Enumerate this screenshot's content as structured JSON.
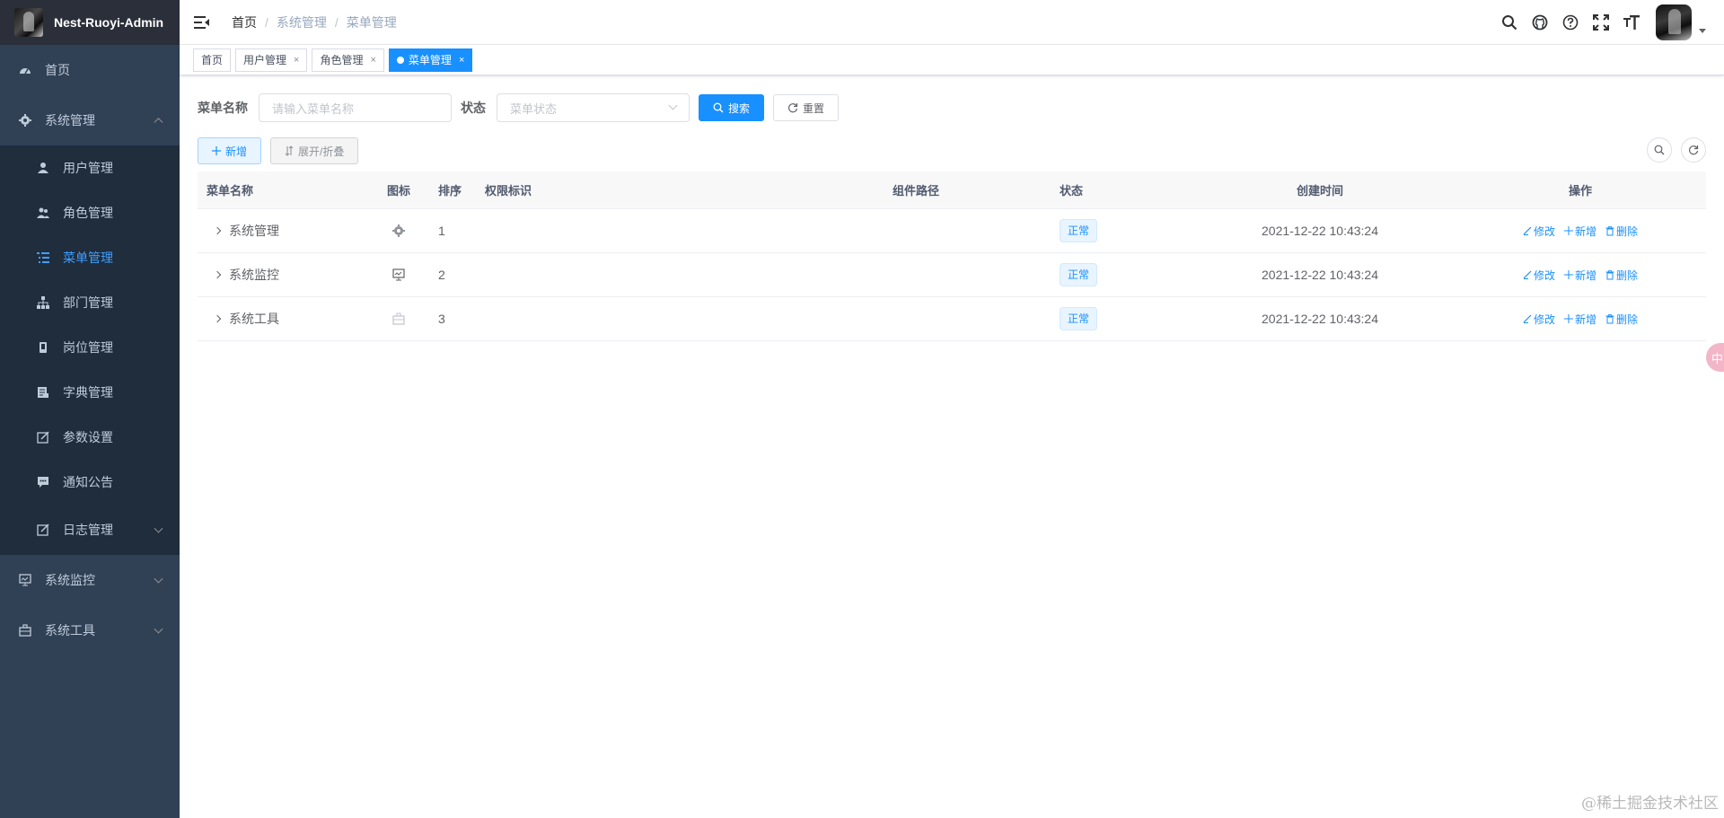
{
  "app": {
    "title": "Nest-Ruoyi-Admin"
  },
  "sidebar": {
    "home": "首页",
    "system": {
      "label": "系统管理",
      "items": [
        {
          "label": "用户管理",
          "icon": "user-icon"
        },
        {
          "label": "角色管理",
          "icon": "peoples-icon"
        },
        {
          "label": "菜单管理",
          "icon": "tree-table-icon"
        },
        {
          "label": "部门管理",
          "icon": "tree-icon"
        },
        {
          "label": "岗位管理",
          "icon": "post-icon"
        },
        {
          "label": "字典管理",
          "icon": "dict-icon"
        },
        {
          "label": "参数设置",
          "icon": "edit-icon"
        },
        {
          "label": "通知公告",
          "icon": "message-icon"
        },
        {
          "label": "日志管理",
          "icon": "log-icon"
        }
      ]
    },
    "monitor": "系统监控",
    "tool": "系统工具"
  },
  "navbar": {
    "breadcrumb": [
      "首页",
      "系统管理",
      "菜单管理"
    ],
    "separator": "/"
  },
  "tags": [
    {
      "label": "首页",
      "closable": false
    },
    {
      "label": "用户管理",
      "closable": true
    },
    {
      "label": "角色管理",
      "closable": true
    },
    {
      "label": "菜单管理",
      "closable": true,
      "active": true
    }
  ],
  "tag_close": "×",
  "search": {
    "name_label": "菜单名称",
    "name_placeholder": "请输入菜单名称",
    "status_label": "状态",
    "status_placeholder": "菜单状态",
    "search_btn": "搜索",
    "reset_btn": "重置"
  },
  "toolbar": {
    "add_btn": "新增",
    "expand_btn": "展开/折叠"
  },
  "table": {
    "headers": [
      "菜单名称",
      "图标",
      "排序",
      "权限标识",
      "组件路径",
      "状态",
      "创建时间",
      "操作"
    ],
    "rows": [
      {
        "name": "系统管理",
        "icon": "system-icon",
        "order": "1",
        "perm": "",
        "path": "",
        "status": "正常",
        "time": "2021-12-22 10:43:24"
      },
      {
        "name": "系统监控",
        "icon": "monitor-icon",
        "order": "2",
        "perm": "",
        "path": "",
        "status": "正常",
        "time": "2021-12-22 10:43:24"
      },
      {
        "name": "系统工具",
        "icon": "tool-icon",
        "order": "3",
        "perm": "",
        "path": "",
        "status": "正常",
        "time": "2021-12-22 10:43:24"
      }
    ],
    "ops": {
      "edit": "修改",
      "add": "新增",
      "delete": "删除"
    }
  },
  "float_badge": "中",
  "watermark": "@稀土掘金技术社区",
  "colors": {
    "sidebar_bg": "#304156",
    "submenu_bg": "#1f2d3d",
    "primary": "#1890ff",
    "active_text": "#409eff"
  }
}
